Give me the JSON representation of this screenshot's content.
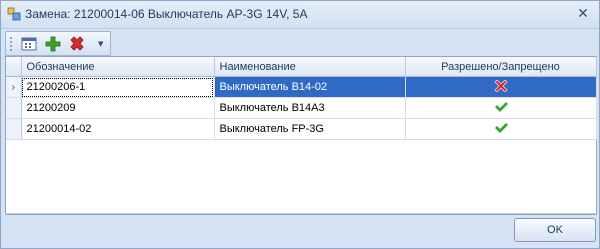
{
  "window": {
    "title": "Замена: 21200014-06 Выключатель АР-3G 14V, 5А"
  },
  "icons": {
    "app": "app-window-icon",
    "close": "close-icon",
    "toolbar": [
      "calendar-icon",
      "add-icon",
      "delete-icon",
      "dropdown-arrow-icon"
    ]
  },
  "grid": {
    "columns": [
      "Обозначение",
      "Наименование",
      "Разрешено/Запрещено"
    ],
    "rows": [
      {
        "designation": "21200206-1",
        "name": "Выключатель B14-02",
        "status": "denied",
        "selected": true
      },
      {
        "designation": "21200209",
        "name": "Выключатель B14A3",
        "status": "allowed",
        "selected": false
      },
      {
        "designation": "21200014-02",
        "name": "Выключатель FP-3G",
        "status": "allowed",
        "selected": false
      }
    ]
  },
  "footer": {
    "ok_label": "OK"
  },
  "colors": {
    "selection": "#316ac5",
    "window_bg": "#d5e2f2",
    "allowed": "#3aa52b",
    "denied": "#d62b2b"
  }
}
